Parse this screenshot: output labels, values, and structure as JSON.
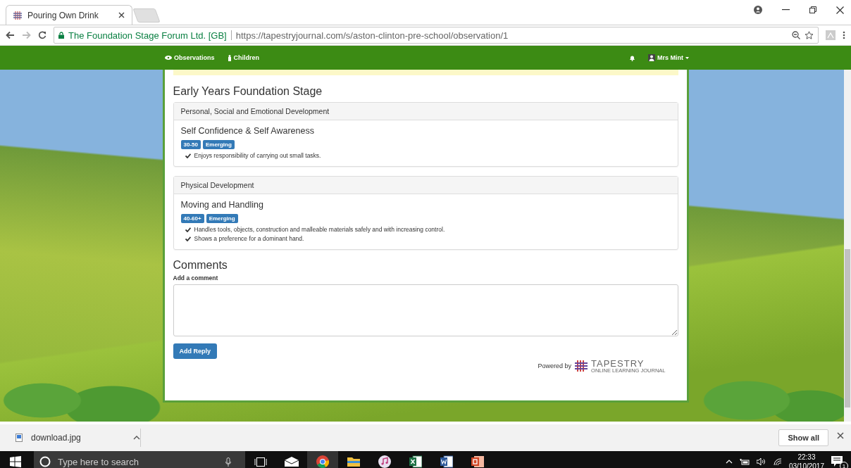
{
  "browser": {
    "tab_title": "Pouring Own Drink",
    "site_identity": "The Foundation Stage Forum Ltd. [GB]",
    "url": "https://tapestryjournal.com/s/aston-clinton-pre-school/observation/1"
  },
  "nav": {
    "items": [
      "Observations",
      "Children"
    ],
    "user": "Mrs Mint"
  },
  "section_title": "Early Years Foundation Stage",
  "areas": [
    {
      "area": "Personal, Social and Emotional Development",
      "aspect": "Self Confidence & Self Awareness",
      "badges": [
        "30-50",
        "Emerging"
      ],
      "statements": [
        "Enjoys responsibility of carrying out small tasks."
      ]
    },
    {
      "area": "Physical Development",
      "aspect": "Moving and Handling",
      "badges": [
        "40-60+",
        "Emerging"
      ],
      "statements": [
        "Handles tools, objects, construction and malleable materials safely and with increasing control.",
        "Shows a preference for a dominant hand."
      ]
    }
  ],
  "comments": {
    "title": "Comments",
    "label": "Add a comment",
    "button": "Add Reply"
  },
  "footer": {
    "powered_by": "Powered by",
    "logo_text": "TAPESTRY",
    "logo_tagline": "ONLINE LEARNING JOURNAL"
  },
  "downloads": {
    "file": "download.jpg",
    "show_all": "Show all"
  },
  "taskbar": {
    "search_placeholder": "Type here to search",
    "time": "22:33",
    "date": "03/10/2017",
    "notifications": "1"
  }
}
